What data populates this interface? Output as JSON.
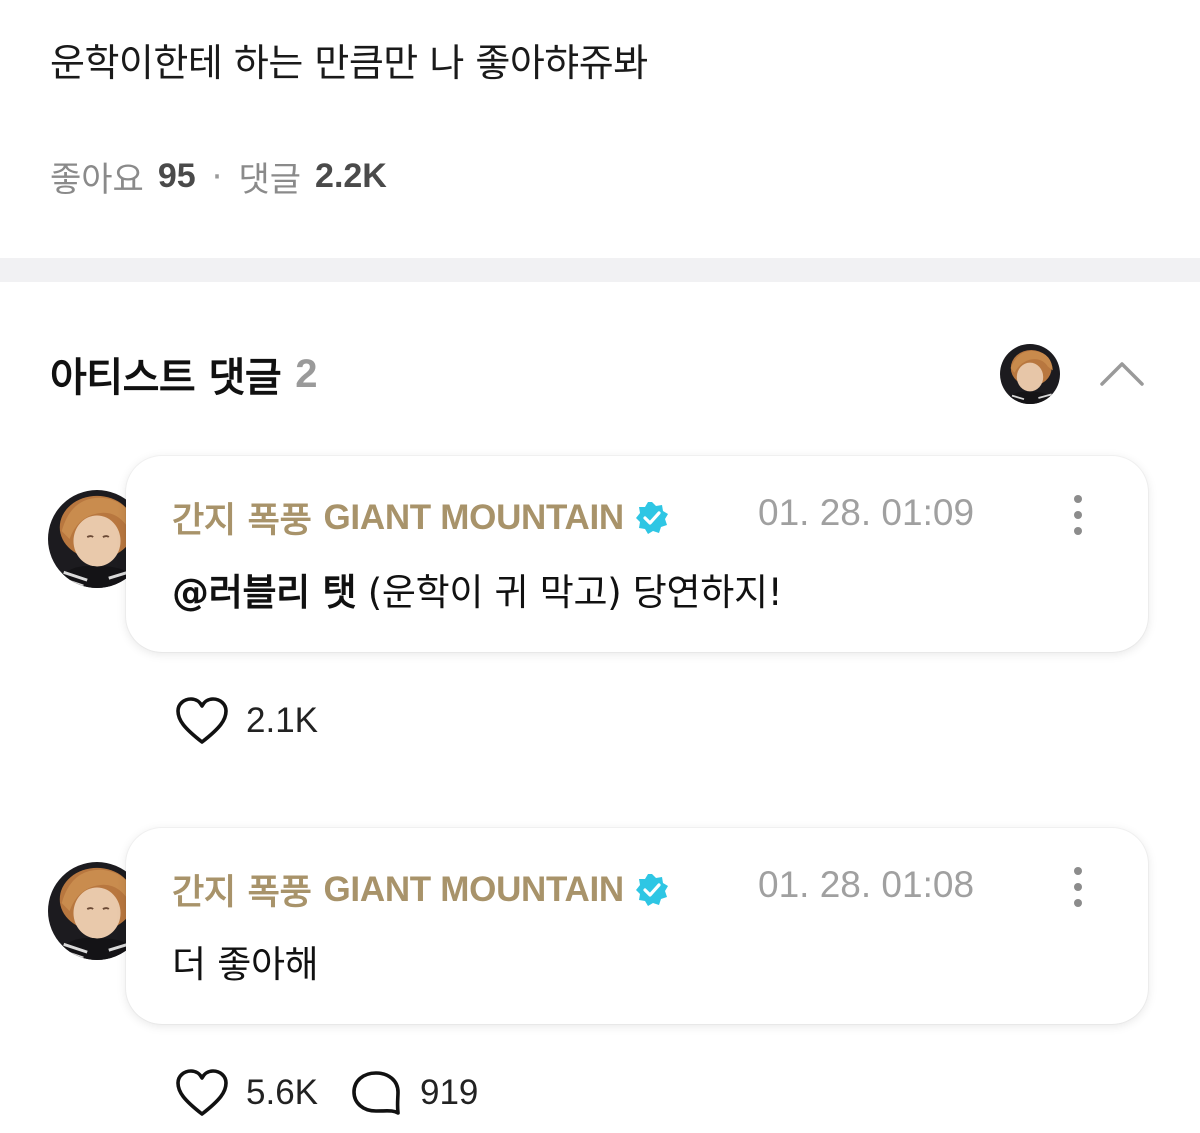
{
  "post": {
    "text": "운학이한테 하는 만큼만 나 좋아햐쥬봐",
    "likes_label": "좋아요",
    "likes_count": "95",
    "separator": "·",
    "comments_label": "댓글",
    "comments_count": "2.2K"
  },
  "artist_comments": {
    "title": "아티스트 댓글",
    "count": "2",
    "collapse_icon": "chevron-up-icon",
    "items": [
      {
        "author_ko": "간지 폭풍",
        "author_en": "GIANT MOUNTAIN",
        "verified_icon": "verified-badge-icon",
        "time": "01. 28. 01:09",
        "mention": "@러블리 탯",
        "body": " (운학이 귀 막고) 당연하지!",
        "like_count": "2.1K"
      },
      {
        "author_ko": "간지 폭풍",
        "author_en": "GIANT MOUNTAIN",
        "verified_icon": "verified-badge-icon",
        "time": "01. 28. 01:08",
        "mention": "",
        "body": "더 좋아해",
        "like_count": "5.6K",
        "reply_count": "919"
      }
    ]
  },
  "colors": {
    "author": "#a8936a",
    "verified": "#2ec6e4",
    "muted": "#8a8a8a",
    "divider": "#f1f1f3"
  }
}
